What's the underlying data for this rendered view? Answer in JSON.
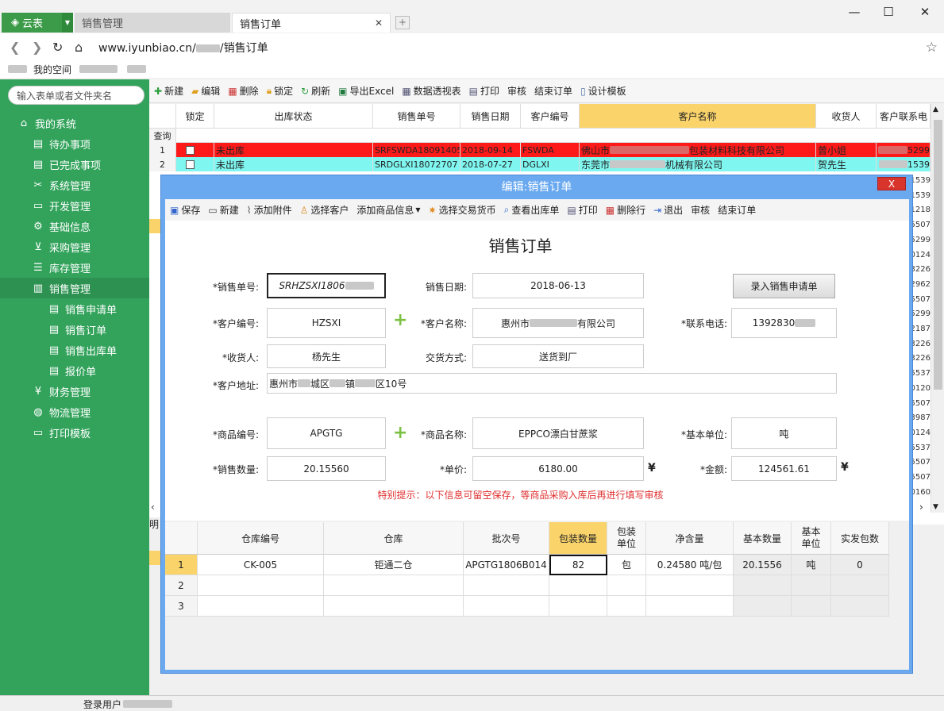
{
  "browser": {
    "brand": "云表",
    "tabs": [
      {
        "label": "销售管理"
      },
      {
        "label": "销售订单"
      }
    ],
    "new_tab": "+",
    "url_host": "www.iyunbiao.cn/",
    "url_path": "/销售订单",
    "bookmarks": [
      "我的空间"
    ]
  },
  "sidebar": {
    "search_placeholder": "输入表单或者文件夹名",
    "items": [
      {
        "label": "我的系统",
        "icon": "home-icon"
      },
      {
        "label": "待办事项",
        "icon": "list-icon"
      },
      {
        "label": "已完成事项",
        "icon": "list-icon"
      },
      {
        "label": "系统管理",
        "icon": "tools-icon"
      },
      {
        "label": "开发管理",
        "icon": "folder-icon"
      },
      {
        "label": "基础信息",
        "icon": "gear-icon"
      },
      {
        "label": "采购管理",
        "icon": "cart-icon"
      },
      {
        "label": "库存管理",
        "icon": "stack-icon"
      },
      {
        "label": "销售管理",
        "icon": "bar-chart-icon"
      },
      {
        "label": "销售申请单",
        "icon": "doc-icon"
      },
      {
        "label": "销售订单",
        "icon": "doc-icon"
      },
      {
        "label": "销售出库单",
        "icon": "doc-icon"
      },
      {
        "label": "报价单",
        "icon": "doc-icon"
      },
      {
        "label": "财务管理",
        "icon": "finance-icon"
      },
      {
        "label": "物流管理",
        "icon": "globe-icon"
      },
      {
        "label": "打印模板",
        "icon": "folder-icon"
      }
    ]
  },
  "toolbar": {
    "new": "新建",
    "edit": "编辑",
    "delete": "删除",
    "lock": "锁定",
    "refresh": "刷新",
    "export": "导出Excel",
    "pivot": "数据透视表",
    "print": "打印",
    "audit": "审核",
    "close_order": "结束订单",
    "design": "设计模板"
  },
  "grid": {
    "headers": [
      "锁定",
      "出库状态",
      "销售单号",
      "销售日期",
      "客户编号",
      "客户名称",
      "收货人",
      "客户联系电"
    ],
    "query_label": "查询",
    "rows": [
      {
        "num": "1",
        "status": "未出库",
        "order_no": "SRFSWDA18091405",
        "date": "2018-09-14",
        "cust_code": "FSWDA",
        "cust_name": "佛山市",
        "cust_name_tail": "包装材料科技有限公司",
        "receiver": "曾小姐",
        "phone": "5299"
      },
      {
        "num": "2",
        "status": "未出库",
        "order_no": "SRDGLXI18072707",
        "date": "2018-07-27",
        "cust_code": "DGLXI",
        "cust_name": "东莞市",
        "cust_name_tail": "机械有限公司",
        "receiver": "贺先生",
        "phone": "1539"
      }
    ],
    "right_values": [
      "1539",
      "1539",
      "1218",
      "5507",
      "5299",
      "0124",
      "3226",
      "2962",
      "5507",
      "5299",
      "2187",
      "3226",
      "3226",
      "5537",
      "0120",
      "5507",
      "3987",
      "0124",
      "5537",
      "5507",
      "5507",
      "0160"
    ]
  },
  "dialog": {
    "title": "编辑:销售订单",
    "close": "X",
    "toolbar": {
      "save": "保存",
      "new": "新建",
      "attach": "添加附件",
      "select_customer": "选择客户",
      "add_product": "添加商品信息",
      "select_currency": "选择交易货币",
      "view_outbound": "查看出库单",
      "print": "打印",
      "delete_row": "删除行",
      "exit": "退出",
      "audit": "审核",
      "close_order": "结束订单"
    },
    "form_title": "销售订单",
    "fields": {
      "order_no_label": "*销售单号:",
      "order_no": "SRHZSXI1806",
      "date_label": "销售日期:",
      "date": "2018-06-13",
      "request_button": "录入销售申请单",
      "cust_code_label": "*客户编号:",
      "cust_code": "HZSXI",
      "cust_name_label": "*客户名称:",
      "cust_name": "惠州市",
      "cust_name_tail": "有限公司",
      "phone_label": "*联系电话:",
      "phone": "1392830",
      "receiver_label": "*收货人:",
      "receiver": "杨先生",
      "delivery_label": "交货方式:",
      "delivery": "送货到厂",
      "address_label": "*客户地址:",
      "address_a": "惠州市",
      "address_b": "城区",
      "address_c": "镇",
      "address_d": "区10号",
      "product_code_label": "*商品编号:",
      "product_code": "APGTG",
      "product_name_label": "*商品名称:",
      "product_name": "EPPCO漂白甘蔗浆",
      "unit_label": "*基本单位:",
      "unit": "吨",
      "qty_label": "*销售数量:",
      "qty": "20.15560",
      "price_label": "*单价:",
      "price": "6180.00",
      "amount_label": "*金额:",
      "amount": "124561.61",
      "yen": "¥"
    },
    "hint": "特别提示：以下信息可留空保存，等商品采购入库后再进行填写审核",
    "detail": {
      "headers": [
        "仓库编号",
        "仓库",
        "批次号",
        "包装数量",
        "包装\n单位",
        "净含量",
        "基本数量",
        "基本\n单位",
        "实发包数"
      ],
      "rows": [
        {
          "num": "1",
          "wh_code": "CK-005",
          "wh": "钜通二仓",
          "batch": "APGTG1806B014",
          "pkg_qty": "82",
          "pkg_unit": "包",
          "net": "0.24580  吨/包",
          "base_qty": "20.1556",
          "base_unit": "吨",
          "shipped": "0"
        },
        {
          "num": "2"
        },
        {
          "num": "3"
        }
      ]
    }
  },
  "status": {
    "user_label": "登录用户"
  }
}
